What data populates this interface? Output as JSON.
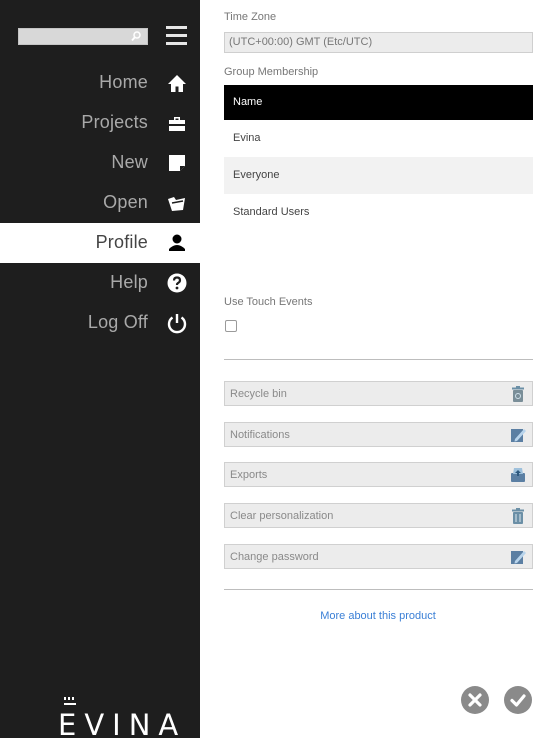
{
  "sidebar": {
    "search": {
      "placeholder": ""
    },
    "menu_icon": "hamburger-menu-icon",
    "items": [
      {
        "label": "Home",
        "icon": "home-icon"
      },
      {
        "label": "Projects",
        "icon": "briefcase-icon"
      },
      {
        "label": "New",
        "icon": "new-note-icon"
      },
      {
        "label": "Open",
        "icon": "open-folder-icon"
      },
      {
        "label": "Profile",
        "icon": "user-icon",
        "active": true
      },
      {
        "label": "Help",
        "icon": "help-icon"
      },
      {
        "label": "Log Off",
        "icon": "power-icon"
      }
    ],
    "logo_text": "EVINA"
  },
  "profile": {
    "time_zone_label": "Time Zone",
    "time_zone_value": "(UTC+00:00) GMT (Etc/UTC)",
    "group_membership_label": "Group Membership",
    "group_table": {
      "header": "Name",
      "rows": [
        "Evina",
        "Everyone",
        "Standard Users"
      ]
    },
    "touch_events_label": "Use Touch Events",
    "touch_events_checked": false,
    "actions": [
      {
        "label": "Recycle bin",
        "icon": "recycle-bin-icon"
      },
      {
        "label": "Notifications",
        "icon": "edit-icon"
      },
      {
        "label": "Exports",
        "icon": "export-icon"
      },
      {
        "label": "Clear personalization",
        "icon": "trash-icon"
      },
      {
        "label": "Change password",
        "icon": "edit-icon"
      }
    ],
    "more_link": "More about this product"
  },
  "dialog_buttons": {
    "cancel_icon": "cancel-icon",
    "confirm_icon": "confirm-icon"
  },
  "colors": {
    "sidebar_bg": "#1e1e1e",
    "header_bg": "#000000",
    "link": "#3a7fd6",
    "button_gray": "#8a8a8a"
  }
}
